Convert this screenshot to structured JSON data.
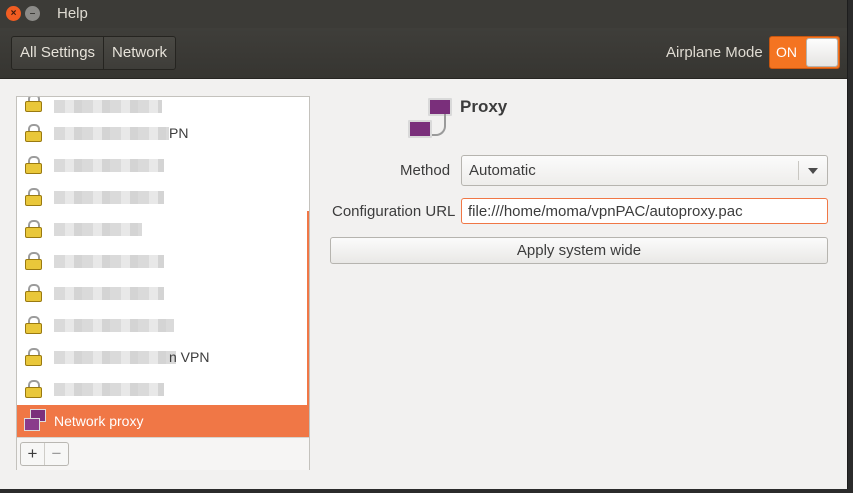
{
  "window": {
    "title": "Help"
  },
  "toolbar": {
    "all_settings": "All Settings",
    "network": "Network",
    "airplane_label": "Airplane Mode",
    "airplane_state": "ON"
  },
  "sidebar": {
    "items": [
      {
        "text": "",
        "icon": "lock-icon"
      },
      {
        "text": "PN",
        "icon": "lock-icon"
      },
      {
        "text": "",
        "icon": "lock-icon"
      },
      {
        "text": "",
        "icon": "lock-icon"
      },
      {
        "text": "",
        "icon": "lock-icon"
      },
      {
        "text": "",
        "icon": "lock-icon"
      },
      {
        "text": "",
        "icon": "lock-icon"
      },
      {
        "text": "",
        "icon": "lock-icon"
      },
      {
        "text": "n VPN",
        "icon": "lock-icon"
      },
      {
        "text": "",
        "icon": "lock-icon"
      }
    ],
    "selected": {
      "label": "Network proxy",
      "icon": "network-proxy-icon"
    },
    "add": "+",
    "remove": "−"
  },
  "proxy": {
    "title": "Proxy",
    "method_label": "Method",
    "method_value": "Automatic",
    "config_label": "Configuration URL",
    "config_value": "file:///home/moma/vpnPAC/autoproxy.pac",
    "apply_label": "Apply system wide"
  },
  "colors": {
    "accent": "#f07746",
    "titlebar": "#3c3b37"
  }
}
